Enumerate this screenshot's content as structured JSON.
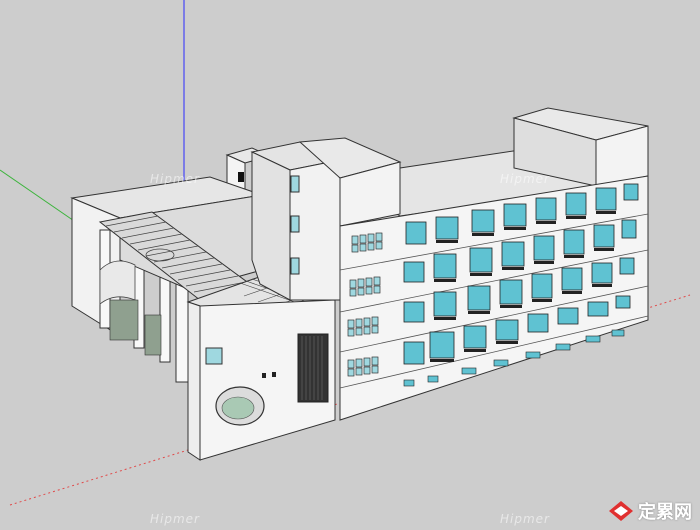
{
  "scene": {
    "background": "#cdcdcd",
    "axis_colors": {
      "blue": "#2a2aff",
      "green": "#3cb43c",
      "red": "#e04a4a"
    }
  },
  "watermarks": [
    "Hipmer",
    "Hipmer",
    "Hipmer",
    "Hipmer"
  ],
  "logo": {
    "text": "定累网",
    "accent": "#e03030"
  }
}
